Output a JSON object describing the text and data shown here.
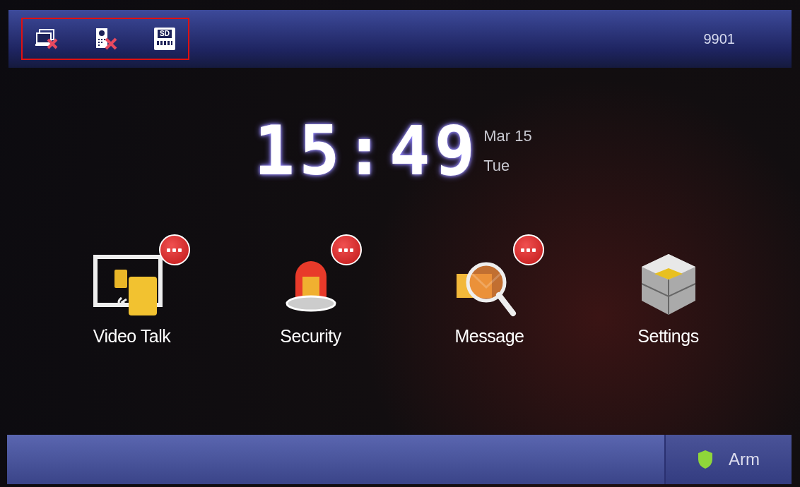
{
  "top_bar": {
    "status_icons": [
      {
        "kind": "display-error"
      },
      {
        "kind": "door-station-error"
      },
      {
        "kind": "sd-card",
        "label": "SD"
      }
    ],
    "highlighted": true,
    "room_number": "9901"
  },
  "clock": {
    "time": "15:49",
    "date": "Mar 15",
    "weekday": "Tue"
  },
  "apps": [
    {
      "kind": "video-talk",
      "label": "Video Talk",
      "badge": true
    },
    {
      "kind": "security",
      "label": "Security",
      "badge": true
    },
    {
      "kind": "message",
      "label": "Message",
      "badge": true
    },
    {
      "kind": "settings",
      "label": "Settings",
      "badge": false
    }
  ],
  "bottom_bar": {
    "arm_label": "Arm"
  }
}
